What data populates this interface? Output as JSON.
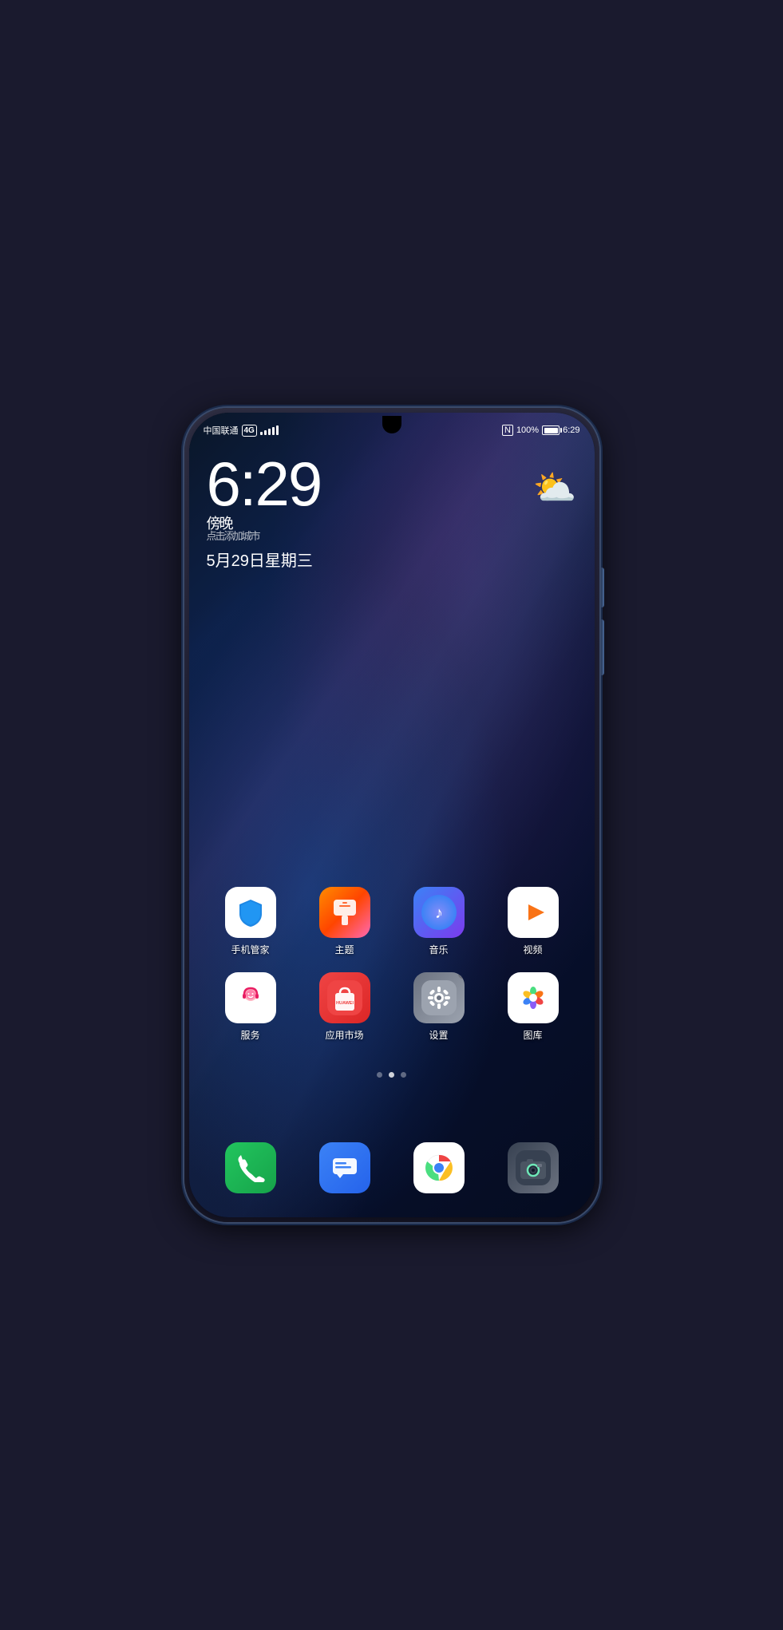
{
  "phone": {
    "status_bar": {
      "carrier": "中国联通",
      "network": "4G",
      "battery_percent": "100%",
      "time": "6:29",
      "nfc": "N"
    },
    "clock": {
      "time": "6:29",
      "period": "傍晚",
      "tap_label": "点击添加城市",
      "date": "5月29日星期三"
    },
    "weather": {
      "icon": "⛅"
    },
    "apps_row1": [
      {
        "id": "phone-manager",
        "label": "手机管家",
        "icon_type": "phone-manager"
      },
      {
        "id": "theme",
        "label": "主题",
        "icon_type": "theme"
      },
      {
        "id": "music",
        "label": "音乐",
        "icon_type": "music"
      },
      {
        "id": "video",
        "label": "视频",
        "icon_type": "video"
      }
    ],
    "apps_row2": [
      {
        "id": "service",
        "label": "服务",
        "icon_type": "service"
      },
      {
        "id": "appstore",
        "label": "应用市场",
        "icon_type": "appstore"
      },
      {
        "id": "settings",
        "label": "设置",
        "icon_type": "settings",
        "badge": true
      },
      {
        "id": "gallery",
        "label": "图库",
        "icon_type": "gallery"
      }
    ],
    "page_dots": [
      {
        "active": false
      },
      {
        "active": true
      },
      {
        "active": false
      }
    ],
    "dock": [
      {
        "id": "phone-call",
        "icon_type": "phone-call"
      },
      {
        "id": "messages",
        "icon_type": "messages"
      },
      {
        "id": "chrome",
        "icon_type": "chrome"
      },
      {
        "id": "camera",
        "icon_type": "camera"
      }
    ]
  }
}
